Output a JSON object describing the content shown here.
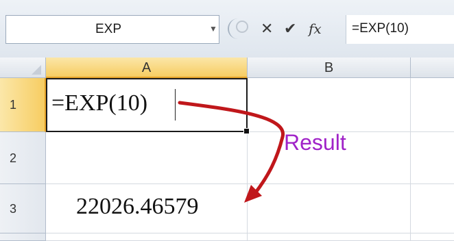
{
  "formula_bar": {
    "name_box": "EXP",
    "formula": "=EXP(10)",
    "fx_label": "fx"
  },
  "grid": {
    "columns": [
      "A",
      "B"
    ],
    "rows": [
      "1",
      "2",
      "3"
    ],
    "cells": {
      "A1": "=EXP(10)",
      "A3": "22026.46579"
    }
  },
  "annotation": {
    "label": "Result",
    "color": "#a023c8",
    "arrow_color": "#c0171b"
  },
  "colors": {
    "selected_header": "#f7cd62",
    "header_border": "#e4a229"
  }
}
